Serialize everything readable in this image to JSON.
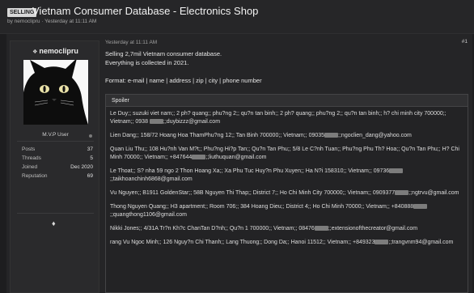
{
  "thread": {
    "badge": "SELLING",
    "title": "Vietnam Consumer Database - Electronics Shop",
    "byline": "by nemoclipru · Yesterday at 11:11 AM"
  },
  "user": {
    "name": "nemoclipru",
    "role": "M.V.P User",
    "stats": [
      {
        "label": "Posts",
        "value": "37"
      },
      {
        "label": "Threads",
        "value": "5"
      },
      {
        "label": "Joined",
        "value": "Dec 2020"
      },
      {
        "label": "Reputation",
        "value": "69"
      }
    ]
  },
  "post": {
    "timestamp": "Yesterday at 11:11 AM",
    "number": "#1",
    "lines": [
      "Selling 2,7mil Vietnam consumer database.",
      "Everything is collected in 2021.",
      "",
      "Format: e-mail | name | address | zip | city | phone number"
    ]
  },
  "spoiler": {
    "label": "Spoiler",
    "records": [
      {
        "pre": "Le Duy;; suzuki viet nam;; 2 ph? quang;; phu?ng 2;; qu?n tan binh;; 2 ph? quang;; phu?ng 2;; qu?n tan binh;; h? chi minh city 700000;; Vietnam;; 0938 ",
        "post": ";;duybizzz@gmail.com"
      },
      {
        "pre": "Lien Dang;; 158/72 Hoang Hoa ThamPhu?ng 12;; Tan Binh 700000;; Vietnam;; 09035",
        "post": ";;ngoclien_dang@yahoo.com"
      },
      {
        "pre": "Quan Liu Thu;; 108 Hu?nh Van M?t;; Phu?ng Hi?p Tan;; Qu?n Tan Phu;; 5/8 Le C?nh Tuan;; Phu?ng Phu Th? Hoa;; Qu?n Tan Phu;; H? Chi Minh 70000;; Vietnam;; +847644",
        "post": ";;liuthuquan@gmail.com"
      },
      {
        "pre": "Le Thoat;; S? nha 59 ngo 2 Thon Hoang Xa;; Xa Phu Tuc Huy?n Phu Xuyen;; Ha N?i 158310;; Vietnam;; 09736",
        "post": ";;taikhoanchinh6868@gmail.com"
      },
      {
        "pre": "Vu Nguyen;; B1911 GoldenStar;; 58B Nguyen Thi Thap;; District 7;; Ho Chi Minh City 700000;; Vietnam;; 0909377",
        "post": ";;ngtrvu@gmail.com"
      },
      {
        "pre": "Thong Nguyen Quang;; H3 apartment;; Room 706;; 384 Hoang Dieu;; District 4;; Ho Chi Minh 70000;; Vietnam;; +840888",
        "post": ";;quangthong1106@gmail.com"
      },
      {
        "pre": "Nikki Jones;; 4/31A Tr?n Kh?c ChanTan D?nh;; Qu?n 1 700000;; Vietnam;; 08476",
        "post": ";;extensionofthecreator@gmail.com"
      },
      {
        "pre": "rang Vu Ngoc Minh;; 126 Nguy?n Chi Thanh;; Lang Thuong;; Dong Da;; Hanoi 11512;; Vietnam;; +849323",
        "post": ";;trangvnm94@gmail.com"
      }
    ]
  },
  "colors": {
    "page_bg": "#1d1d1f",
    "panel_bg": "#252527",
    "text": "#dedede"
  }
}
